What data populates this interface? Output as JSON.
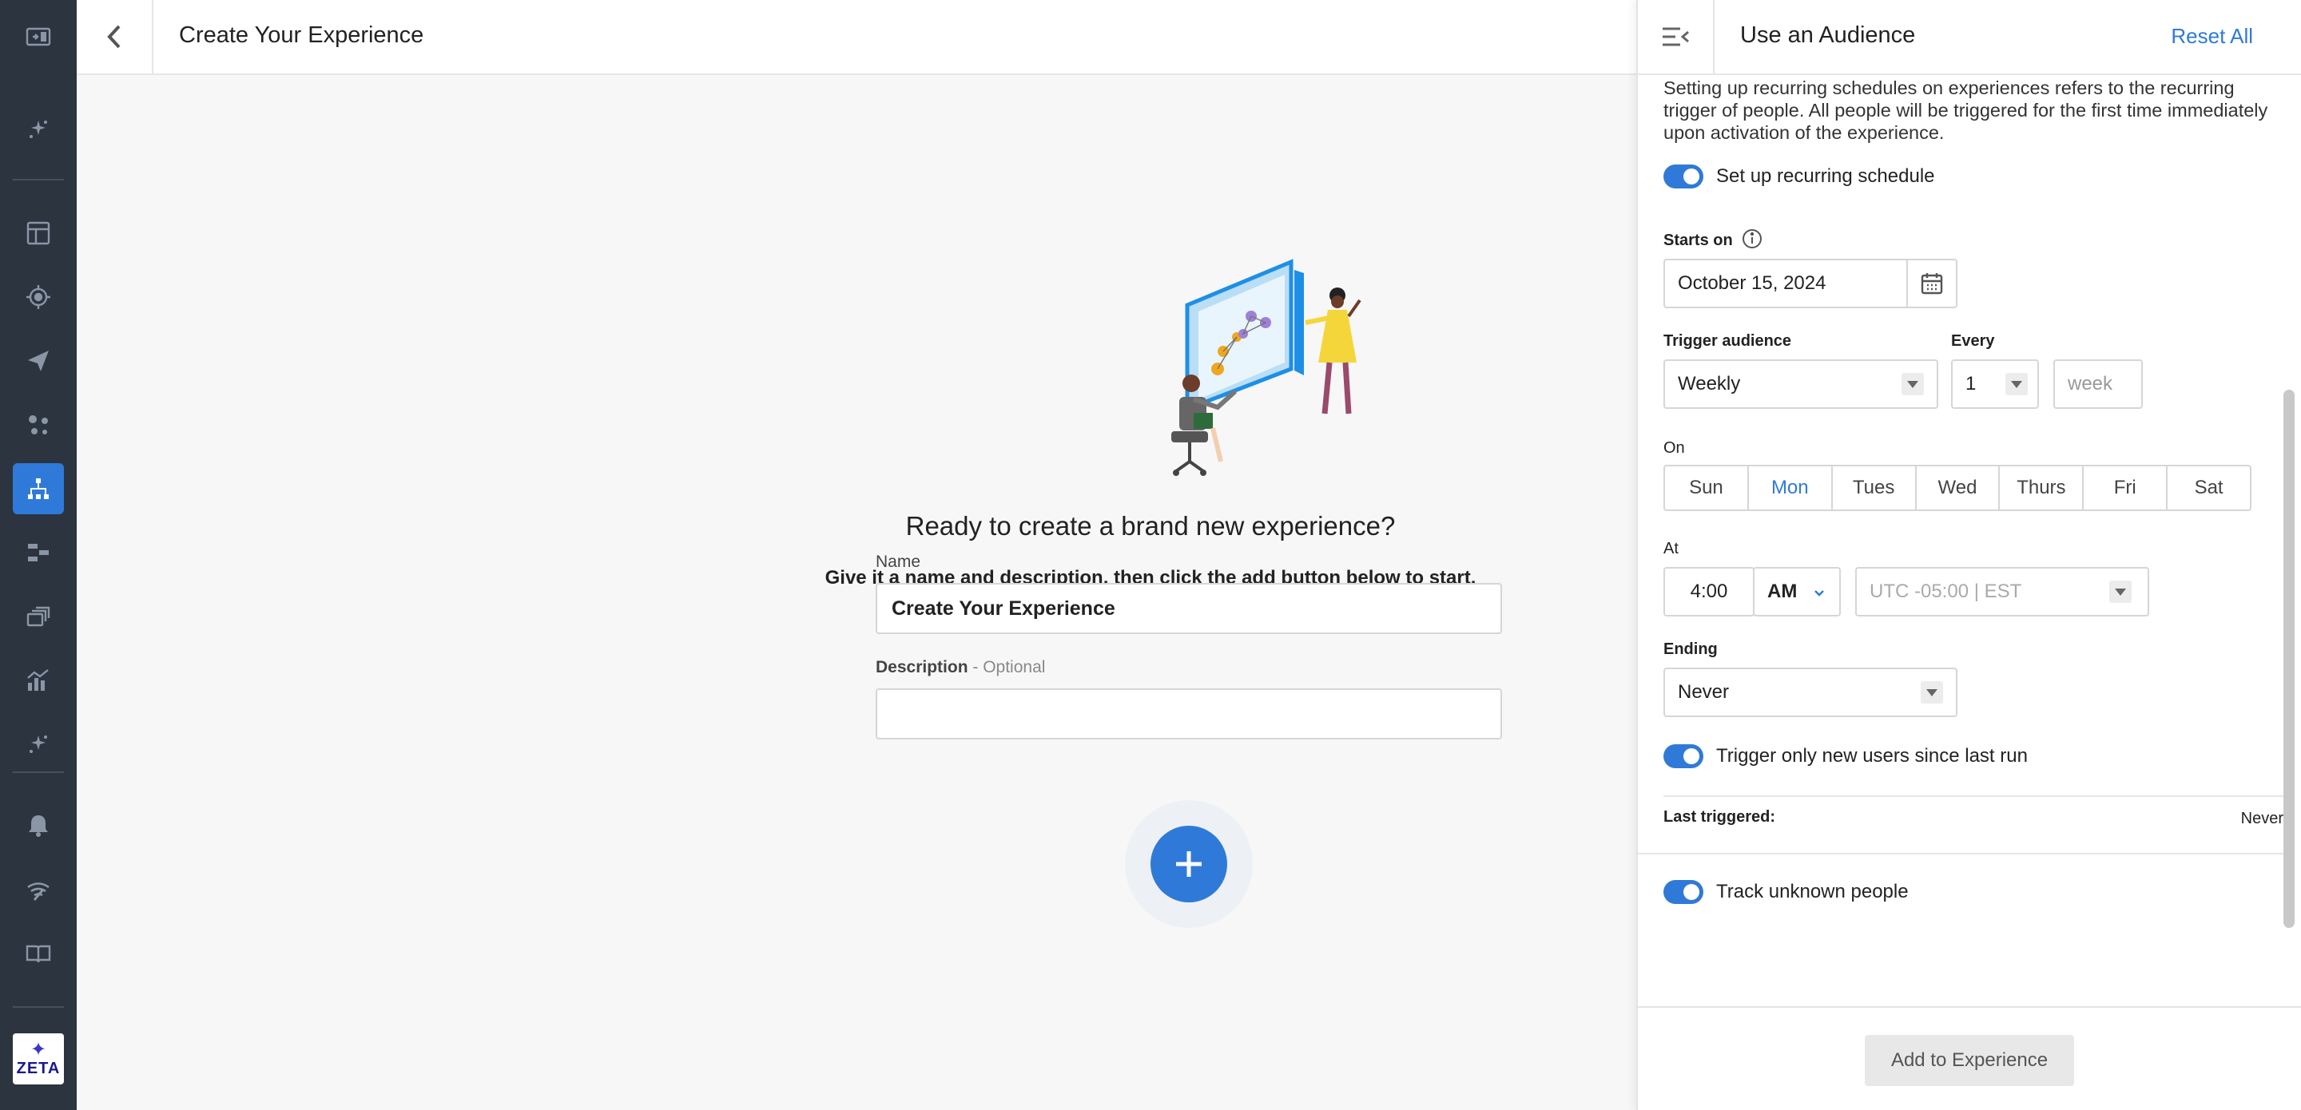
{
  "header": {
    "title": "Create Your Experience"
  },
  "main": {
    "heading": "Ready to create a brand new experience?",
    "subheading": "Give it a name and description, then click the add button below to start.",
    "name_label": "Name",
    "name_value": "Create Your Experience",
    "description_label": "Description",
    "description_optional": " - Optional",
    "description_value": ""
  },
  "panel": {
    "title": "Use an Audience",
    "reset_label": "Reset All",
    "intro": "Setting up recurring schedules on experiences refers to the recurring trigger of people. All people will be triggered for the first time immediately upon activation of the experience.",
    "recurring_toggle_label": "Set up recurring schedule",
    "recurring_toggle_on": true,
    "starts_on_label": "Starts on",
    "starts_on_value": "October 15, 2024",
    "trigger_audience_label": "Trigger audience",
    "trigger_audience_value": "Weekly",
    "every_label": "Every",
    "every_value": "1",
    "every_unit": "week",
    "on_label": "On",
    "days": [
      "Sun",
      "Mon",
      "Tues",
      "Wed",
      "Thurs",
      "Fri",
      "Sat"
    ],
    "selected_day": "Mon",
    "at_label": "At",
    "time_value": "4:00",
    "ampm_value": "AM",
    "timezone_value": "UTC -05:00 | EST",
    "ending_label": "Ending",
    "ending_value": "Never",
    "new_users_toggle_label": "Trigger only new users since last run",
    "new_users_toggle_on": true,
    "last_triggered_label": "Last triggered:",
    "last_triggered_value": "Never",
    "track_toggle_label": "Track unknown people",
    "track_toggle_on": true,
    "add_button_label": "Add to Experience"
  },
  "nav": {
    "icons": [
      "panel-toggle-icon",
      "sparkle-icon",
      "dashboard-icon",
      "target-icon",
      "send-icon",
      "network-icon",
      "hierarchy-icon",
      "flow-icon",
      "layers-icon",
      "chart-icon",
      "sparkle-icon",
      "bell-icon",
      "signal-icon",
      "book-icon"
    ],
    "active": "hierarchy-icon",
    "logo_text": "ZETA"
  },
  "colors": {
    "accent": "#2f7ad8",
    "nav_bg": "#2c3440",
    "page_bg": "#f7f7f7"
  }
}
